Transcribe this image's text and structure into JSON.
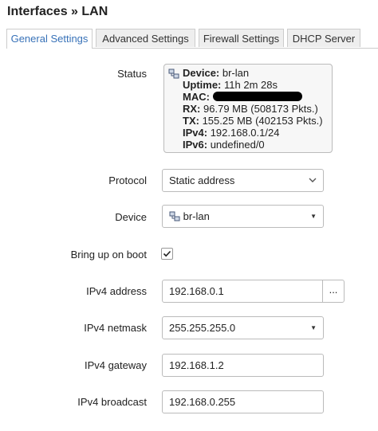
{
  "page": {
    "title": "Interfaces » LAN"
  },
  "tabs": [
    {
      "label": "General Settings"
    },
    {
      "label": "Advanced Settings"
    },
    {
      "label": "Firewall Settings"
    },
    {
      "label": "DHCP Server"
    }
  ],
  "status": {
    "label": "Status",
    "device_key": "Device:",
    "device_val": "br-lan",
    "uptime_key": "Uptime:",
    "uptime_val": "11h 2m 28s",
    "mac_key": "MAC:",
    "rx_key": "RX:",
    "rx_val": "96.79 MB (508173 Pkts.)",
    "tx_key": "TX:",
    "tx_val": "155.25 MB (402153 Pkts.)",
    "ipv4_key": "IPv4:",
    "ipv4_val": "192.168.0.1/24",
    "ipv6_key": "IPv6:",
    "ipv6_val": "undefined/0"
  },
  "protocol": {
    "label": "Protocol",
    "value": "Static address"
  },
  "device": {
    "label": "Device",
    "value": "br-lan"
  },
  "boot": {
    "label": "Bring up on boot",
    "checked": true
  },
  "ipv4_address": {
    "label": "IPv4 address",
    "value": "192.168.0.1",
    "button": "..."
  },
  "ipv4_netmask": {
    "label": "IPv4 netmask",
    "value": "255.255.255.0"
  },
  "ipv4_gateway": {
    "label": "IPv4 gateway",
    "value": "192.168.1.2"
  },
  "ipv4_broadcast": {
    "label": "IPv4 broadcast",
    "value": "192.168.0.255"
  },
  "icons": {
    "device": "network-device-icon",
    "check": "checkmark-icon",
    "dropdown": "chevron-down-icon"
  }
}
